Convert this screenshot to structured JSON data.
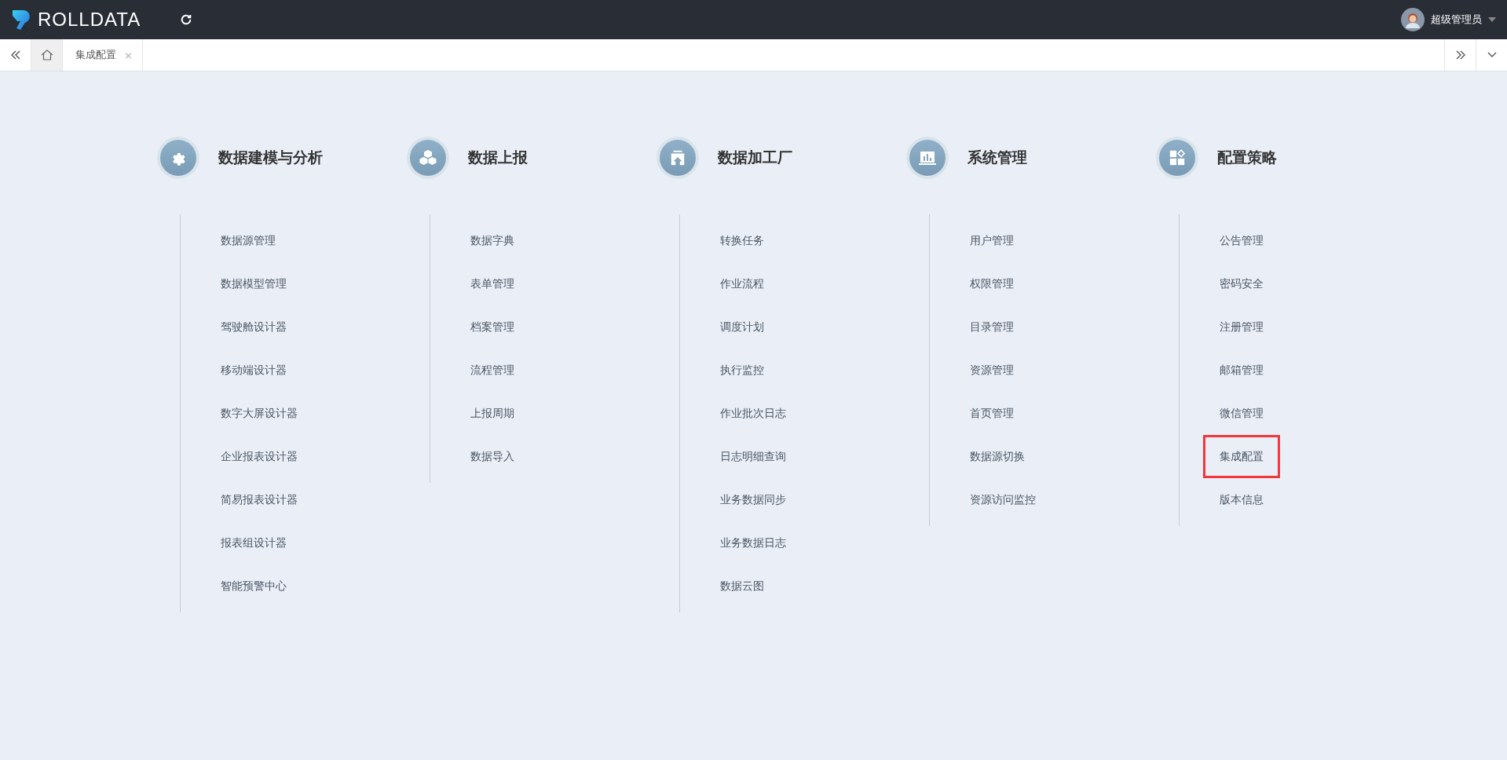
{
  "header": {
    "logo": "ROLLDATA",
    "user": "超级管理员"
  },
  "tabs": [
    {
      "label": "集成配置",
      "close": "×",
      "selected": true
    }
  ],
  "groups": [
    {
      "title": "数据建模与分析",
      "items": [
        {
          "label": "数据源管理",
          "selected": false
        },
        {
          "label": "数据模型管理",
          "selected": false
        },
        {
          "label": "驾驶舱设计器",
          "selected": false
        },
        {
          "label": "移动端设计器",
          "selected": false
        },
        {
          "label": "数字大屏设计器",
          "selected": false
        },
        {
          "label": "企业报表设计器",
          "selected": false
        },
        {
          "label": "简易报表设计器",
          "selected": false
        },
        {
          "label": "报表组设计器",
          "selected": false
        },
        {
          "label": "智能预警中心",
          "selected": false
        }
      ]
    },
    {
      "title": "数据上报",
      "items": [
        {
          "label": "数据字典",
          "selected": false
        },
        {
          "label": "表单管理",
          "selected": false
        },
        {
          "label": "档案管理",
          "selected": false
        },
        {
          "label": "流程管理",
          "selected": false
        },
        {
          "label": "上报周期",
          "selected": false
        },
        {
          "label": "数据导入",
          "selected": false
        }
      ]
    },
    {
      "title": "数据加工厂",
      "items": [
        {
          "label": "转换任务",
          "selected": false
        },
        {
          "label": "作业流程",
          "selected": false
        },
        {
          "label": "调度计划",
          "selected": false
        },
        {
          "label": "执行监控",
          "selected": false
        },
        {
          "label": "作业批次日志",
          "selected": false
        },
        {
          "label": "日志明细查询",
          "selected": false
        },
        {
          "label": "业务数据同步",
          "selected": false
        },
        {
          "label": "业务数据日志",
          "selected": false
        },
        {
          "label": "数据云图",
          "selected": false
        }
      ]
    },
    {
      "title": "系统管理",
      "items": [
        {
          "label": "用户管理",
          "selected": false
        },
        {
          "label": "权限管理",
          "selected": false
        },
        {
          "label": "目录管理",
          "selected": false
        },
        {
          "label": "资源管理",
          "selected": false
        },
        {
          "label": "首页管理",
          "selected": false
        },
        {
          "label": "数据源切换",
          "selected": false
        },
        {
          "label": "资源访问监控",
          "selected": false
        }
      ]
    },
    {
      "title": "配置策略",
      "items": [
        {
          "label": "公告管理",
          "selected": false
        },
        {
          "label": "密码安全",
          "selected": false
        },
        {
          "label": "注册管理",
          "selected": false
        },
        {
          "label": "邮箱管理",
          "selected": false
        },
        {
          "label": "微信管理",
          "selected": false
        },
        {
          "label": "集成配置",
          "selected": true
        },
        {
          "label": "版本信息",
          "selected": false
        }
      ]
    }
  ]
}
